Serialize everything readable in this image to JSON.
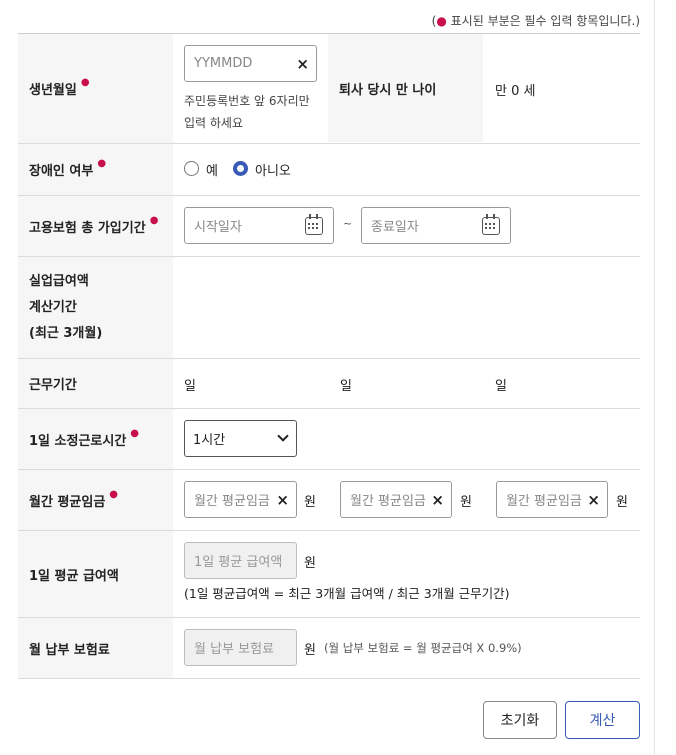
{
  "notice": {
    "open": "(",
    "dot": "●",
    "text": " 표시된 부분은 필수 입력 항목입니다.)"
  },
  "required_mark": "●",
  "rows": {
    "birth": {
      "label": "생년월일",
      "placeholder": "YYMMDD",
      "clear": "×",
      "hint_line1": "주민등록번호 앞 6자리만",
      "hint_line2": "입력 하세요",
      "age_label": "퇴사 당시 만 나이",
      "age_value": "만 0 세"
    },
    "disability": {
      "label": "장애인 여부",
      "options": [
        "예",
        "아니오"
      ],
      "selected": "아니오"
    },
    "insurance_period": {
      "label": "고용보험 총 가입기간",
      "start_placeholder": "시작일자",
      "tilde": "~",
      "end_placeholder": "종료일자"
    },
    "calc_period": {
      "label_line1": "실업급여액",
      "label_line2": "계산기간",
      "label_line3": "(최근 3개월)"
    },
    "work_period": {
      "label": "근무기간",
      "unit": "일"
    },
    "hours": {
      "label": "1일 소정근로시간",
      "selected": "1시간"
    },
    "monthly_wage": {
      "label": "월간 평균임금",
      "placeholder": "월간 평균임금",
      "clear": "×",
      "unit": "원"
    },
    "daily_benefit": {
      "label": "1일 평균 급여액",
      "placeholder": "1일 평균 급여액",
      "unit": "원",
      "formula": "(1일 평균급여액 = 최근 3개월 급여액 / 최근 3개월 근무기간)"
    },
    "premium": {
      "label": "월 납부 보험료",
      "placeholder": "월 납부 보험료",
      "unit": "원",
      "formula": "(월 납부 보험료 = 월 평균급여 X 0.9%)"
    }
  },
  "buttons": {
    "reset": "초기화",
    "calculate": "계산"
  },
  "colors": {
    "required": "#c8104a",
    "accent": "#3a5bb5",
    "label_bg": "#f6f6f6"
  },
  "icons": {
    "clear": "close-icon",
    "calendar": "calendar-icon",
    "dropdown": "chevron-down-icon"
  }
}
